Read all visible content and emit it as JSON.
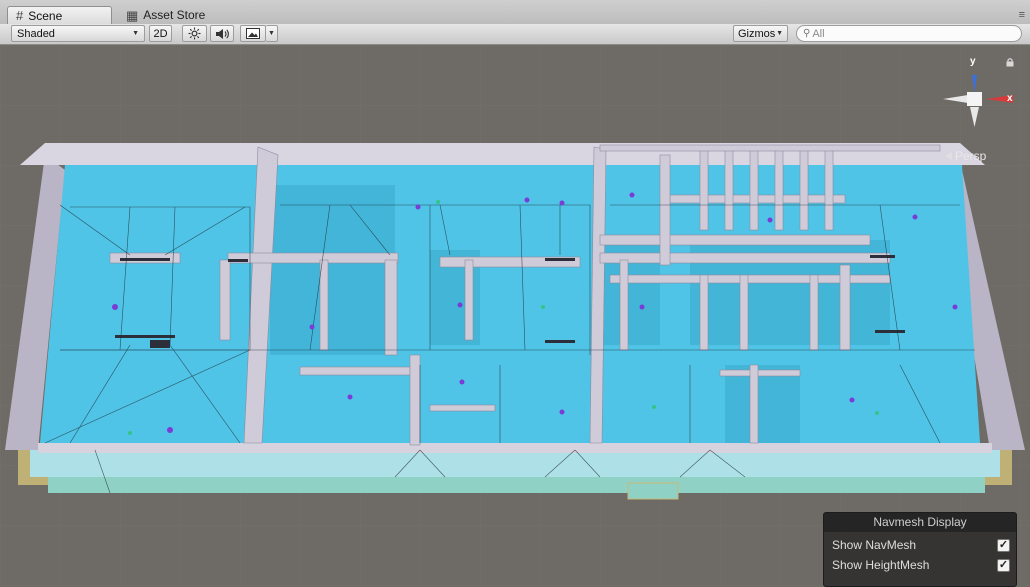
{
  "tabs": [
    {
      "label": "Scene",
      "icon": "hash-icon",
      "active": true
    },
    {
      "label": "Asset Store",
      "icon": "store-icon",
      "active": false
    }
  ],
  "toolbar": {
    "shading_mode": "Shaded",
    "mode_2d": "2D",
    "gizmos_label": "Gizmos",
    "search_placeholder": "All"
  },
  "scene": {
    "projection_label": "Persp",
    "axis_labels": {
      "y": "y",
      "x": "x"
    },
    "colors": {
      "navmesh": "#4fc4e6",
      "walls": "#c9c5d2",
      "background": "#6e6b66"
    }
  },
  "navmesh_display": {
    "title": "Navmesh Display",
    "options": [
      {
        "label": "Show NavMesh",
        "checked": true
      },
      {
        "label": "Show HeightMesh",
        "checked": true
      }
    ]
  }
}
